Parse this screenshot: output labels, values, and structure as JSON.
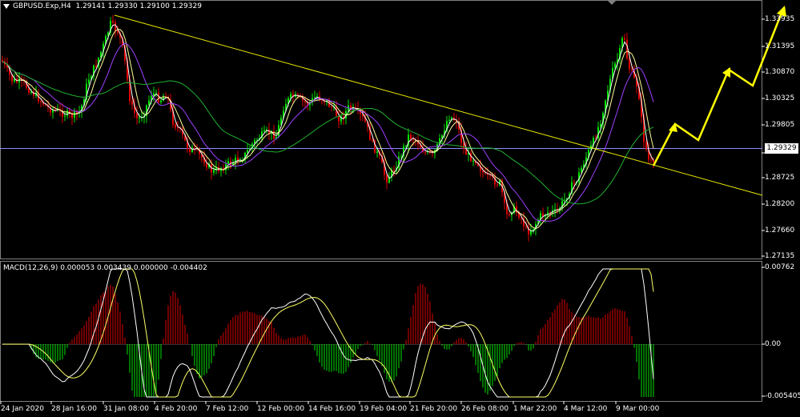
{
  "header": {
    "symbol": "GBPUSD.Exp,H4",
    "ohlc": "1.29141  1.29330  1.29100  1.29329"
  },
  "macd": {
    "label": "MACD(12,26,9) 0.000053 0.003439 0.000000 -0.004402"
  },
  "price_axis": {
    "ticks": [
      "1.33935",
      "1.31395",
      "1.30870",
      "1.30325",
      "1.29805",
      "1.28725",
      "1.28200",
      "1.27660",
      "1.27135"
    ],
    "current": "1.29329"
  },
  "macd_axis": {
    "ticks": [
      "0.00762",
      "0.00",
      "-0.005405"
    ]
  },
  "time_axis": {
    "labels": [
      "24 Jan 2020",
      "28 Jan 16:00",
      "31 Jan 08:00",
      "4 Feb 20:00",
      "7 Feb 12:00",
      "12 Feb 00:00",
      "14 Feb 16:00",
      "19 Feb 04:00",
      "21 Feb 20:00",
      "26 Feb 08:00",
      "1 Mar 22:00",
      "4 Mar 12:00",
      "9 Mar 00:00"
    ]
  },
  "colors": {
    "background": "#000000",
    "bull": "#00e400",
    "bear": "#e00000",
    "ma_fast": "#ffffff",
    "ma_mid": "#ffff99",
    "ma_slow": "#a040ff",
    "ma_long": "#20b030",
    "trendline": "#e8e800",
    "arrows": "#ffff00",
    "current_line": "#8c8cff",
    "macd_line": "#ffffff",
    "signal_line": "#ffff66"
  }
}
